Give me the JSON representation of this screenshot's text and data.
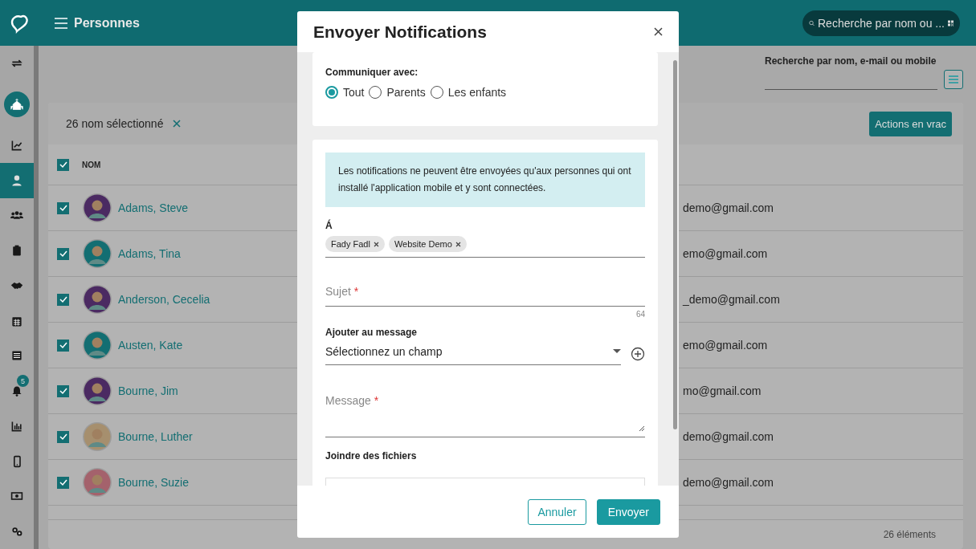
{
  "header": {
    "title": "Personnes",
    "search_placeholder": "Recherche par nom ou ..."
  },
  "sidebar": {
    "items": [
      {
        "kind": "swap",
        "selected": false
      },
      {
        "kind": "church"
      },
      {
        "kind": "chart",
        "selected": false
      },
      {
        "kind": "person",
        "selected": true
      },
      {
        "kind": "group",
        "selected": false
      },
      {
        "kind": "clipboard",
        "selected": false
      },
      {
        "kind": "handshake",
        "selected": false
      },
      {
        "kind": "calendar",
        "selected": false
      },
      {
        "kind": "list",
        "selected": false
      },
      {
        "kind": "bell",
        "selected": false,
        "badge": "5"
      },
      {
        "kind": "bars",
        "selected": false
      },
      {
        "kind": "phone",
        "selected": false
      },
      {
        "kind": "money",
        "selected": false
      },
      {
        "kind": "gears",
        "selected": false
      }
    ]
  },
  "filter": {
    "label": "Recherche par nom, e-mail ou mobile"
  },
  "selection": {
    "text": "26 nom sélectionné",
    "bulk_button": "Actions en vrac"
  },
  "table": {
    "columns": [
      "NOM"
    ],
    "all_checked": true,
    "rows": [
      {
        "name": "Adams, Steve",
        "checked": true,
        "color": "#4b2a62",
        "email": "demo@gmail.com"
      },
      {
        "name": "Adams, Tina",
        "checked": true,
        "color": "#136e72",
        "email": "emo@gmail.com"
      },
      {
        "name": "Anderson, Cecelia",
        "checked": true,
        "color": "#4b2a62",
        "email": "_demo@gmail.com"
      },
      {
        "name": "Austen, Kate",
        "checked": true,
        "color": "#136e72",
        "email": "emo@gmail.com"
      },
      {
        "name": "Bourne, Jim",
        "checked": true,
        "color": "#4b2a62",
        "email": "mo@gmail.com"
      },
      {
        "name": "Bourne, Luther",
        "checked": true,
        "color": "#a68f6e",
        "email": "demo@gmail.com"
      },
      {
        "name": "Bourne, Suzie",
        "checked": true,
        "color": "#a4626c",
        "email": "demo@gmail.com"
      }
    ],
    "footer": "26 éléments"
  },
  "dialog": {
    "title": "Envoyer Notifications",
    "audience": {
      "label": "Communiquer avec:",
      "options": [
        {
          "label": "Tout",
          "selected": true
        },
        {
          "label": "Parents",
          "selected": false
        },
        {
          "label": "Les enfants",
          "selected": false
        }
      ]
    },
    "notice": "Les notifications ne peuvent être envoyées qu'aux personnes qui ont installé l'application mobile et y sont connectées.",
    "recipients": {
      "label": "Á",
      "chips": [
        "Fady Fadl",
        "Website Demo"
      ]
    },
    "subject": {
      "placeholder": "Sujet",
      "marker": "*",
      "counter": "64"
    },
    "insert": {
      "label": "Ajouter au message",
      "value": "Sélectionnez un champ"
    },
    "message": {
      "placeholder": "Message",
      "marker": "*"
    },
    "attachments": {
      "label": "Joindre des fichiers"
    },
    "buttons": {
      "cancel": "Annuler",
      "send": "Envoyer"
    }
  }
}
